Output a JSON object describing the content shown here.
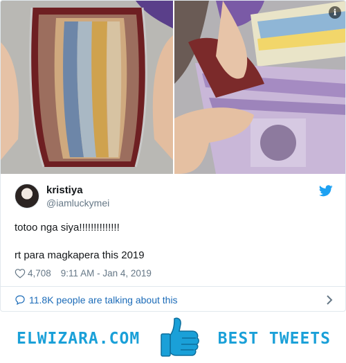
{
  "tweet": {
    "author_name": "kristiya",
    "author_handle": "@iamluckymei",
    "text": "totoo nga siya!!!!!!!!!!!!!!\n\nrt para magkapera this 2019",
    "likes": "4,708",
    "timestamp": "9:11 AM - Jan 4, 2019",
    "talking": "11.8K people are talking about this"
  },
  "banner": {
    "left_text": "ELWIZARA.COM",
    "right_text": "BEST TWEETS"
  },
  "icons": {
    "info": "i",
    "twitter": "twitter-bird-icon",
    "heart": "heart-icon",
    "comment": "comment-bubble-icon",
    "chevron": "chevron-right-icon",
    "thumb": "thumbs-up-icon"
  },
  "colors": {
    "twitter_blue": "#1da1f2",
    "link_blue": "#1b6bb8",
    "brand_blue": "#1aa0d8",
    "muted": "#657786"
  }
}
